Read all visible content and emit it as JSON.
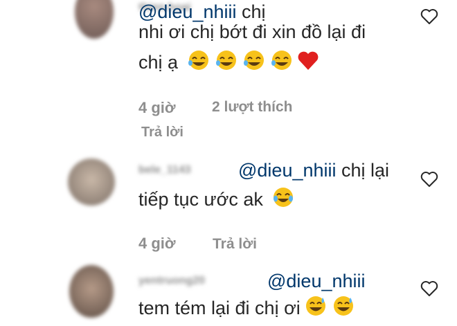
{
  "comments": [
    {
      "username": "thien.hoai",
      "mention": "@dieu_nhiii",
      "lines": [
        "chị",
        "nhi ơi chị bớt đi xin đồ lại đi",
        "chị ạ"
      ],
      "emoji_laugh_count": 4,
      "emoji_heart": true,
      "time": "4 giờ",
      "likes": "2 lượt thích",
      "reply": "Trả lời"
    },
    {
      "username": "bele_1143",
      "mention": "@dieu_nhiii",
      "lines": [
        "chị lại",
        "tiếp tục ước ak"
      ],
      "time": "4 giờ",
      "reply": "Trả lời"
    },
    {
      "username": "yentruong20",
      "mention": "@dieu_nhiii",
      "lines": [
        "tem tém lại đi chị ơi"
      ]
    }
  ],
  "colors": {
    "text": "#262626",
    "mention": "#00376b",
    "meta": "#8e8e8e",
    "heart_red": "#e0201f",
    "emoji_yellow": "#f7c21b"
  }
}
